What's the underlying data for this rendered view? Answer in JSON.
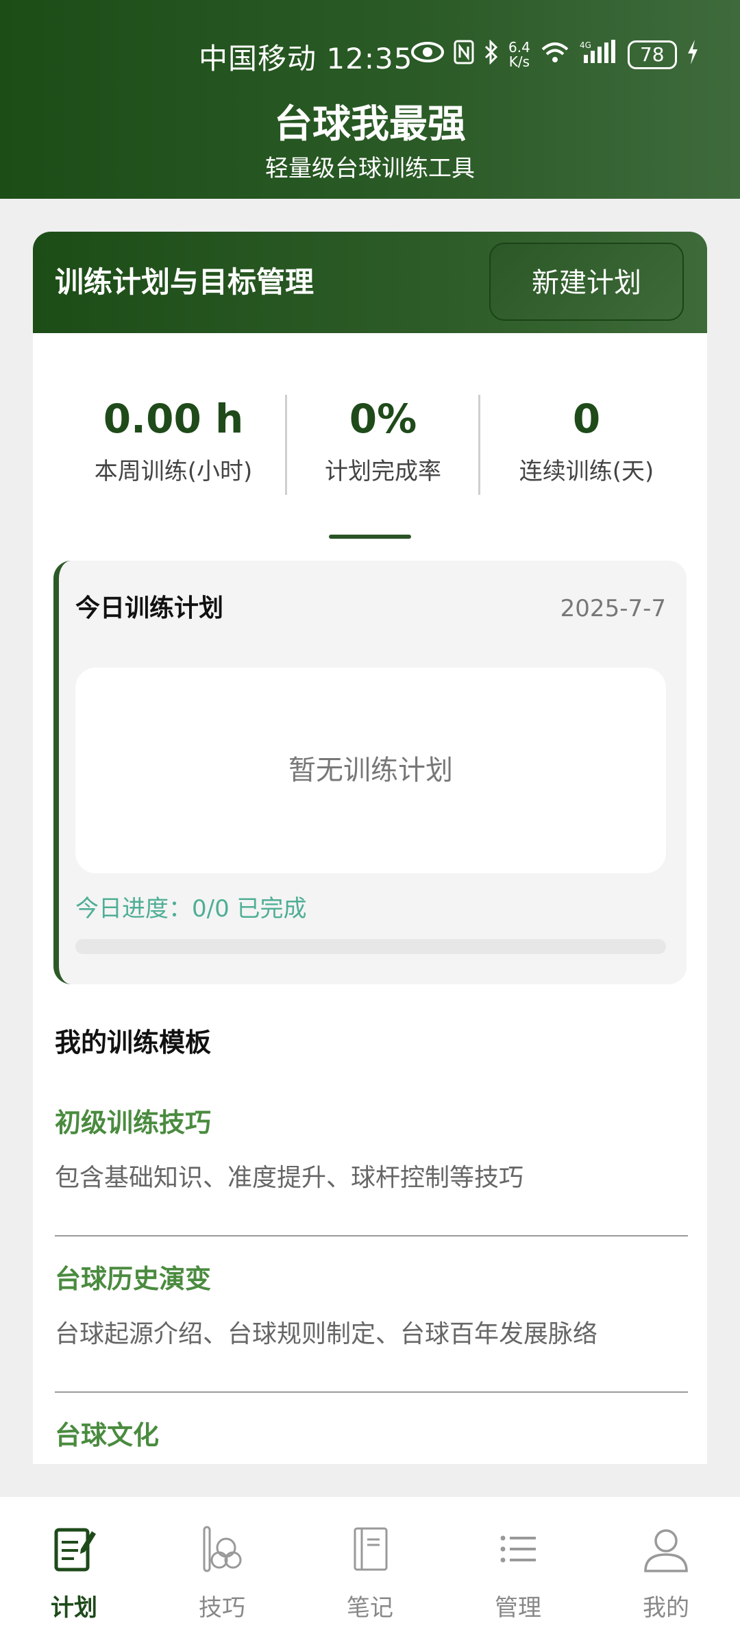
{
  "status_bar": {
    "carrier": "中国移动",
    "time": "12:35",
    "net_speed_top": "6.4",
    "net_speed_bottom": "K/s",
    "network": "4G",
    "battery": "78"
  },
  "app": {
    "title": "台球我最强",
    "subtitle": "轻量级台球训练工具"
  },
  "plan_card": {
    "title": "训练计划与目标管理",
    "new_plan_label": "新建计划",
    "stats": [
      {
        "value": "0.00 h",
        "label": "本周训练(小时)"
      },
      {
        "value": "0%",
        "label": "计划完成率"
      },
      {
        "value": "0",
        "label": "连续训练(天)"
      }
    ],
    "today": {
      "title": "今日训练计划",
      "date": "2025-7-7",
      "empty_text": "暂无训练计划",
      "progress_text": "今日进度：0/0 已完成",
      "progress_fraction": 0
    },
    "templates": {
      "title": "我的训练模板",
      "items": [
        {
          "name": "初级训练技巧",
          "desc": "包含基础知识、准度提升、球杆控制等技巧"
        },
        {
          "name": "台球历史演变",
          "desc": "台球起源介绍、台球规则制定、台球百年发展脉络"
        },
        {
          "name": "台球文化",
          "desc": ""
        }
      ]
    }
  },
  "bottom_nav": {
    "items": [
      {
        "label": "计划",
        "icon": "plan-icon",
        "active": true
      },
      {
        "label": "技巧",
        "icon": "cue-balls-icon",
        "active": false
      },
      {
        "label": "笔记",
        "icon": "notebook-icon",
        "active": false
      },
      {
        "label": "管理",
        "icon": "list-icon",
        "active": false
      },
      {
        "label": "我的",
        "icon": "profile-icon",
        "active": false
      }
    ]
  },
  "colors": {
    "brand_dark_green": "#1d4d17",
    "accent_teal": "#4fae95",
    "template_green": "#4a8b3f"
  }
}
